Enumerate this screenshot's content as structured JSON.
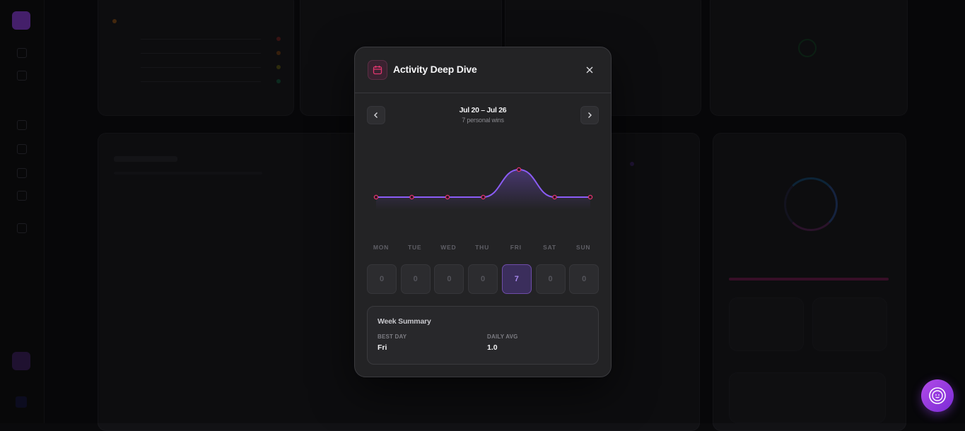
{
  "modal": {
    "title": "Activity Deep Dive",
    "icon": "calendar-icon",
    "close_icon": "close-icon",
    "week": {
      "range": "Jul 20 – Jul 26",
      "subtitle": "7 personal wins",
      "prev_icon": "chevron-left-icon",
      "next_icon": "chevron-right-icon"
    },
    "days": [
      {
        "label": "MON",
        "value": "0",
        "active": false
      },
      {
        "label": "TUE",
        "value": "0",
        "active": false
      },
      {
        "label": "WED",
        "value": "0",
        "active": false
      },
      {
        "label": "THU",
        "value": "0",
        "active": false
      },
      {
        "label": "FRI",
        "value": "7",
        "active": true
      },
      {
        "label": "SAT",
        "value": "0",
        "active": false
      },
      {
        "label": "SUN",
        "value": "0",
        "active": false
      }
    ],
    "summary": {
      "title": "Week Summary",
      "best_day_label": "BEST DAY",
      "best_day_value": "Fri",
      "daily_avg_label": "DAILY AVG",
      "daily_avg_value": "1.0"
    }
  },
  "chart_data": {
    "type": "line",
    "categories": [
      "MON",
      "TUE",
      "WED",
      "THU",
      "FRI",
      "SAT",
      "SUN"
    ],
    "values": [
      0,
      0,
      0,
      0,
      7,
      0,
      0
    ],
    "ylim": [
      0,
      7
    ],
    "line_color": "#8b5cf6",
    "point_color": "#e0366e",
    "grid": false
  },
  "colors": {
    "accent": "#8b5cf6",
    "highlight": "#e0366e",
    "modal_bg": "#232325"
  },
  "fab": {
    "icon": "smile-icon"
  }
}
